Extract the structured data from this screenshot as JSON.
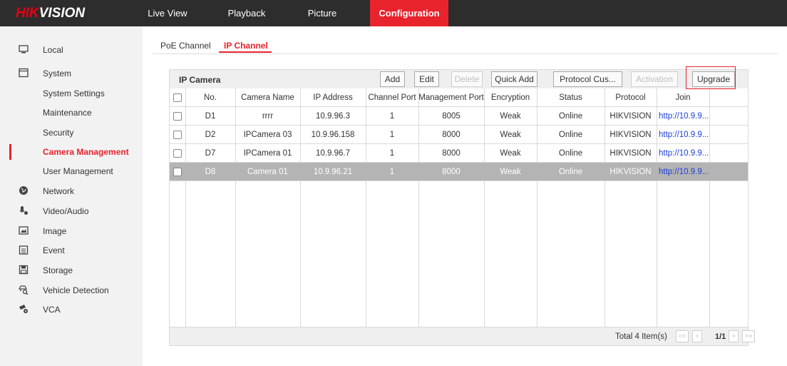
{
  "brand": {
    "hik": "HIK",
    "vision": "VISION"
  },
  "nav": [
    {
      "label": "Live View"
    },
    {
      "label": "Playback"
    },
    {
      "label": "Picture"
    },
    {
      "label": "Configuration",
      "active": true
    }
  ],
  "sidebar": {
    "items": [
      {
        "label": "Local",
        "icon": "monitor-icon"
      },
      {
        "label": "System",
        "icon": "system-icon"
      },
      {
        "label": "System Settings"
      },
      {
        "label": "Maintenance"
      },
      {
        "label": "Security"
      },
      {
        "label": "Camera Management",
        "active": true
      },
      {
        "label": "User Management"
      },
      {
        "label": "Network",
        "icon": "globe-icon"
      },
      {
        "label": "Video/Audio",
        "icon": "microphone-icon"
      },
      {
        "label": "Image",
        "icon": "image-icon"
      },
      {
        "label": "Event",
        "icon": "calendar-icon"
      },
      {
        "label": "Storage",
        "icon": "floppy-disk-icon"
      },
      {
        "label": "Vehicle Detection",
        "icon": "vehicle-search-icon"
      },
      {
        "label": "VCA",
        "icon": "camera-gear-icon"
      }
    ]
  },
  "tabs": {
    "poe": "PoE Channel",
    "ip": "IP Channel"
  },
  "panel": {
    "title": "IP Camera",
    "buttons": {
      "add": "Add",
      "edit": "Edit",
      "delete": "Delete",
      "quick_add": "Quick Add",
      "protocol": "Protocol Cus...",
      "activation": "Activation",
      "upgrade": "Upgrade"
    },
    "columns": [
      "No.",
      "Camera Name",
      "IP Address",
      "Channel Port",
      "Management Port",
      "Encryption",
      "Status",
      "Protocol",
      "Join"
    ],
    "rows": [
      [
        "D1",
        "rrrr",
        "10.9.96.3",
        "1",
        "8005",
        "Weak",
        "Online",
        "HIKVISION",
        "http://10.9.9..."
      ],
      [
        "D2",
        "IPCamera 03",
        "10.9.96.158",
        "1",
        "8000",
        "Weak",
        "Online",
        "HIKVISION",
        "http://10.9.9..."
      ],
      [
        "D7",
        "IPCamera 01",
        "10.9.96.7",
        "1",
        "8000",
        "Weak",
        "Online",
        "HIKVISION",
        "http://10.9.9..."
      ],
      [
        "D8",
        "Camera 01",
        "10.9.96.21",
        "1",
        "8000",
        "Weak",
        "Online",
        "HIKVISION",
        "http://10.9.9..."
      ]
    ],
    "selected_row": 3,
    "footer": {
      "total": "Total 4 Item(s)",
      "first": "<<",
      "prev": "<",
      "page": "1/1",
      "next": ">",
      "last": ">>"
    }
  },
  "colors": {
    "accent": "#e8232c",
    "topbar": "#2d2d2d",
    "sidebar": "#f2f2f2",
    "selected_row": "#b4b4b4",
    "link": "#1e3fd6"
  }
}
